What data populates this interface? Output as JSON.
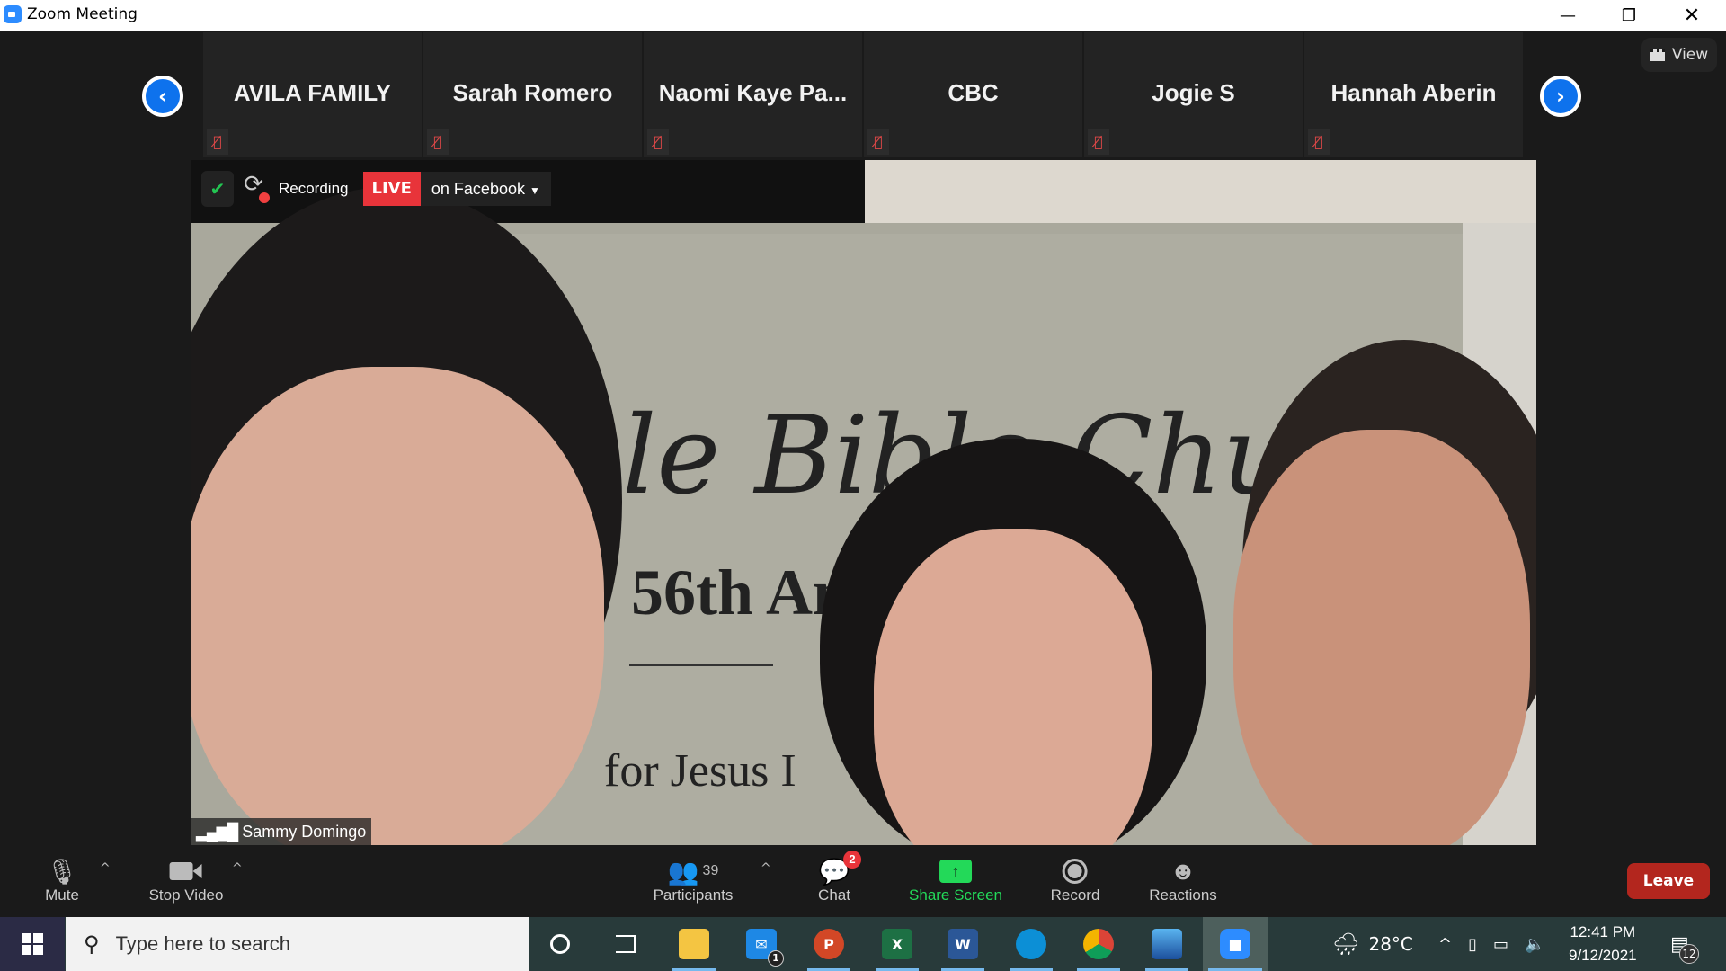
{
  "window": {
    "title": "Zoom Meeting",
    "controls": [
      "minimize",
      "restore",
      "close"
    ]
  },
  "view_button": {
    "label": "View",
    "icon": "grid-icon"
  },
  "nav": {
    "prev_icon": "chevron-left-icon",
    "next_icon": "chevron-right-icon"
  },
  "participants_strip": [
    {
      "name": "AVILA FAMILY",
      "muted": true
    },
    {
      "name": "Sarah Romero",
      "muted": true
    },
    {
      "name": "Naomi  Kaye  Pa...",
      "muted": true
    },
    {
      "name": "CBC",
      "muted": true
    },
    {
      "name": "Jogie S",
      "muted": true
    },
    {
      "name": "Hannah Aberin",
      "muted": true
    }
  ],
  "video": {
    "speaker_name": "Sammy Domingo",
    "recording_label": "Recording",
    "live_label": "LIVE",
    "live_target": "on Facebook",
    "backdrop_text": [
      "le Bible Chu",
      "56th Ann",
      "for Jesus I"
    ]
  },
  "toolbar": {
    "mute": "Mute",
    "stop_video": "Stop Video",
    "participants": "Participants",
    "participants_count": "39",
    "chat": "Chat",
    "chat_badge": "2",
    "share_screen": "Share Screen",
    "record": "Record",
    "reactions": "Reactions",
    "leave": "Leave"
  },
  "taskbar": {
    "search_placeholder": "Type here to search",
    "mail_badge": "1",
    "temperature": "28°C",
    "time": "12:41 PM",
    "date": "9/12/2021",
    "notifications_count": "12",
    "apps": [
      "cortana",
      "task-view",
      "file-explorer",
      "mail",
      "powerpoint",
      "excel",
      "word",
      "edge",
      "chrome",
      "photos",
      "zoom"
    ]
  },
  "colors": {
    "accent": "#0e72ed",
    "live": "#e8343a",
    "share": "#23d959",
    "leave": "#b3261e"
  }
}
